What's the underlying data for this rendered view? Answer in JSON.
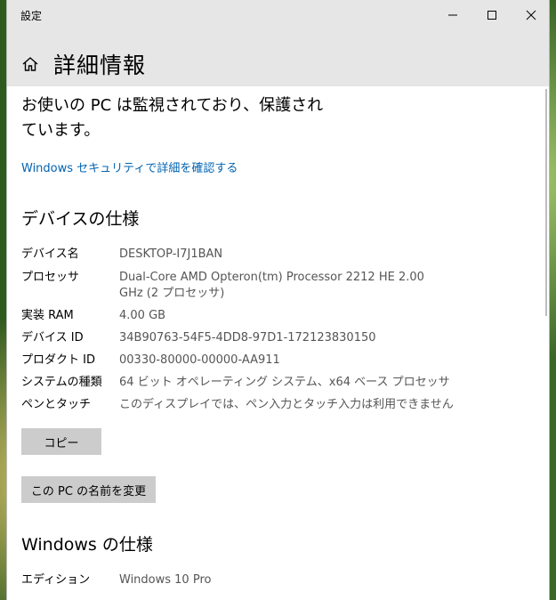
{
  "window": {
    "app_title": "設定"
  },
  "header": {
    "title": "詳細情報"
  },
  "protection": {
    "message": "お使いの PC は監視されており、保護されています。",
    "link": "Windows セキュリティで詳細を確認する"
  },
  "device_specs": {
    "heading": "デバイスの仕様",
    "rows": [
      {
        "label": "デバイス名",
        "value": "DESKTOP-I7J1BAN"
      },
      {
        "label": "プロセッサ",
        "value": "Dual-Core AMD Opteron(tm) Processor 2212 HE   2.00 GHz  (2 プロセッサ)"
      },
      {
        "label": "実装 RAM",
        "value": "4.00 GB"
      },
      {
        "label": "デバイス ID",
        "value": "34B90763-54F5-4DD8-97D1-172123830150"
      },
      {
        "label": "プロダクト ID",
        "value": "00330-80000-00000-AA911"
      },
      {
        "label": "システムの種類",
        "value": "64 ビット オペレーティング システム、x64 ベース プロセッサ"
      },
      {
        "label": "ペンとタッチ",
        "value": "このディスプレイでは、ペン入力とタッチ入力は利用できません"
      }
    ],
    "copy_button": "コピー",
    "rename_button": "この PC の名前を変更"
  },
  "windows_specs": {
    "heading": "Windows の仕様",
    "rows": [
      {
        "label": "エディション",
        "value": "Windows 10 Pro"
      }
    ]
  },
  "colors": {
    "link": "#0063b1",
    "chrome": "#e6e6e6",
    "button": "#cccccc"
  }
}
